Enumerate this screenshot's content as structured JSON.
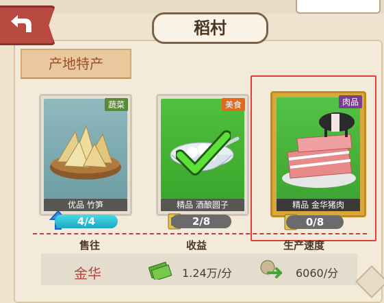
{
  "title": "稻村",
  "section_tab": "产地特产",
  "cards": [
    {
      "category": "蔬菜",
      "category_color": "#5b8a34",
      "name": "优品 竹笋",
      "count": "4/4"
    },
    {
      "category": "美食",
      "category_color": "#e06a1f",
      "name": "精品 酒酿圆子",
      "count": "2/8"
    },
    {
      "category": "肉品",
      "category_color": "#7a3e8c",
      "name": "精品 金华猪肉",
      "count": "0/8"
    }
  ],
  "stats": {
    "sell_to_label": "售往",
    "income_label": "收益",
    "speed_label": "生产速度",
    "sell_to_value": "金华",
    "income_value": "1.24万/分",
    "speed_value": "6060/分"
  },
  "colors": {
    "accent_red": "#b83f37",
    "selection_outline": "#e23f3b"
  }
}
